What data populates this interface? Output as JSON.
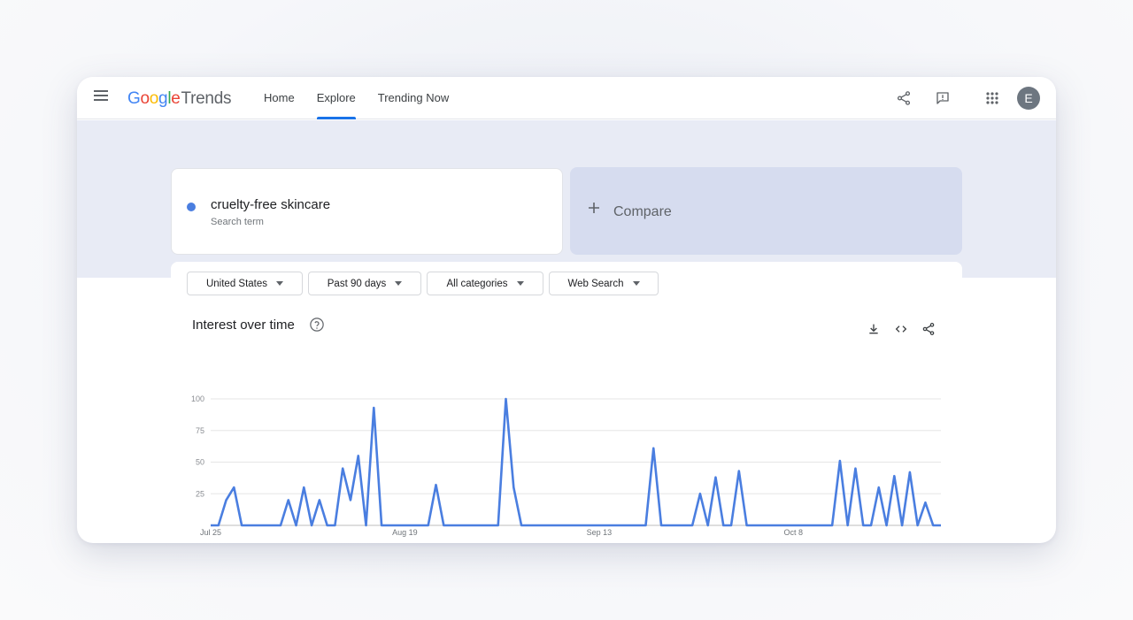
{
  "nav": {
    "home": "Home",
    "explore": "Explore",
    "trending": "Trending Now"
  },
  "logo": {
    "g1": "G",
    "o1": "o",
    "o2": "o",
    "g2": "g",
    "l": "l",
    "e": "e",
    "trends": "Trends"
  },
  "user": {
    "initial": "E"
  },
  "search_term": {
    "title": "cruelty-free skincare",
    "subtitle": "Search term",
    "color": "#4a7ee0"
  },
  "compare": {
    "label": "Compare"
  },
  "filters": {
    "region": "United States",
    "time": "Past 90 days",
    "category": "All categories",
    "search_type": "Web Search"
  },
  "chart": {
    "title": "Interest over time"
  },
  "icons": {
    "menu": "menu-icon",
    "share": "share-icon",
    "feedback": "feedback-icon",
    "apps": "apps-icon",
    "help": "help-icon",
    "download": "download-icon",
    "embed": "embed-icon"
  },
  "chart_data": {
    "type": "line",
    "title": "Interest over time",
    "xlabel": "",
    "ylabel": "",
    "ylim": [
      0,
      100
    ],
    "y_ticks": [
      "100",
      "75",
      "50",
      "25"
    ],
    "x_ticks": [
      {
        "label": "Jul 25",
        "index": 0
      },
      {
        "label": "Aug 19",
        "index": 25
      },
      {
        "label": "Sep 13",
        "index": 50
      },
      {
        "label": "Oct 8",
        "index": 75
      }
    ],
    "grid": true,
    "series": [
      {
        "color": "#4a7ee0",
        "values": [
          0,
          0,
          20,
          30,
          0,
          0,
          0,
          0,
          0,
          0,
          20,
          0,
          30,
          0,
          20,
          0,
          0,
          45,
          20,
          55,
          0,
          93,
          0,
          0,
          0,
          0,
          0,
          0,
          0,
          32,
          0,
          0,
          0,
          0,
          0,
          0,
          0,
          0,
          100,
          30,
          0,
          0,
          0,
          0,
          0,
          0,
          0,
          0,
          0,
          0,
          0,
          0,
          0,
          0,
          0,
          0,
          0,
          61,
          0,
          0,
          0,
          0,
          0,
          25,
          0,
          38,
          0,
          0,
          43,
          0,
          0,
          0,
          0,
          0,
          0,
          0,
          0,
          0,
          0,
          0,
          0,
          51,
          0,
          45,
          0,
          0,
          30,
          0,
          39,
          0,
          42,
          0,
          18,
          0,
          0
        ]
      }
    ]
  }
}
